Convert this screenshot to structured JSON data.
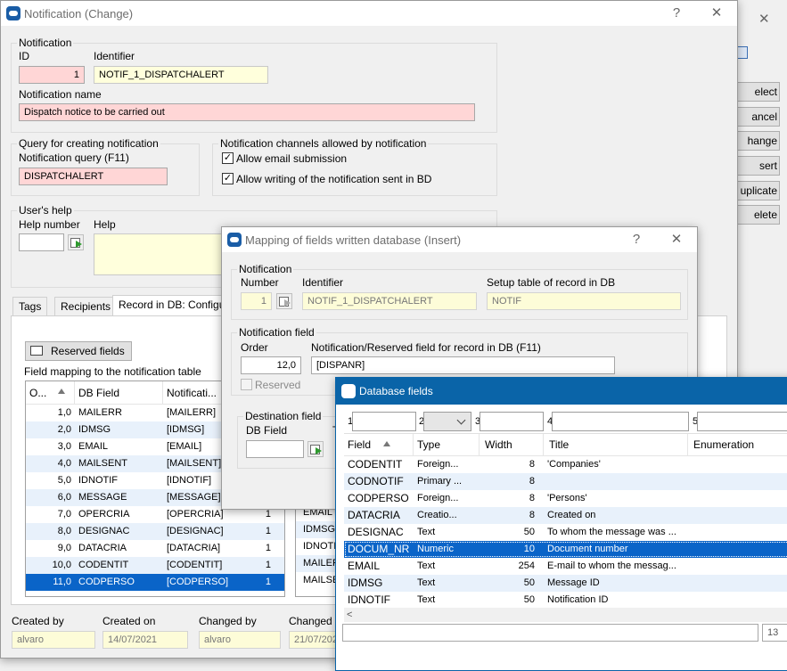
{
  "bg_window": {
    "buttons": [
      "elect",
      "ancel",
      "hange",
      "sert",
      "uplicate",
      "elete"
    ]
  },
  "main_window": {
    "title": "Notification (Change)",
    "help_btn": "?",
    "close_btn": "✕",
    "notification_group": "Notification",
    "id_label": "ID",
    "id_value": "1",
    "identifier_label": "Identifier",
    "identifier_value": "NOTIF_1_DISPATCHALERT",
    "name_label": "Notification name",
    "name_value": "Dispatch notice to be carried out",
    "query_group": "Query for creating notification",
    "query_label": "Notification query (F11)",
    "query_value": "DISPATCHALERT",
    "channels_group": "Notification channels allowed by notification",
    "allow_email": "Allow email submission",
    "allow_db": "Allow writing of the notification sent in BD",
    "help_group": "User's help",
    "help_number_label": "Help number",
    "help_label": "Help",
    "tabs": [
      "Tags",
      "Recipients",
      "Record in DB: Configu"
    ],
    "reserved_fields_btn": "Reserved fields",
    "mapping_label": "Field mapping to the notification table",
    "grid_headers": [
      "O...",
      "DB Field",
      "Notificati..."
    ],
    "grid_rows": [
      {
        "order": "1,0",
        "field": "MAILERR",
        "notif": "[MAILERR]",
        "extra": ""
      },
      {
        "order": "2,0",
        "field": "IDMSG",
        "notif": "[IDMSG]",
        "extra": ""
      },
      {
        "order": "3,0",
        "field": "EMAIL",
        "notif": "[EMAIL]",
        "extra": ""
      },
      {
        "order": "4,0",
        "field": "MAILSENT",
        "notif": "[MAILSENT]",
        "extra": ""
      },
      {
        "order": "5,0",
        "field": "IDNOTIF",
        "notif": "[IDNOTIF]",
        "extra": ""
      },
      {
        "order": "6,0",
        "field": "MESSAGE",
        "notif": "[MESSAGE]",
        "extra": ""
      },
      {
        "order": "7,0",
        "field": "OPERCRIA",
        "notif": "[OPERCRIA]",
        "extra": "1"
      },
      {
        "order": "8,0",
        "field": "DESIGNAC",
        "notif": "[DESIGNAC]",
        "extra": "1"
      },
      {
        "order": "9,0",
        "field": "DATACRIA",
        "notif": "[DATACRIA]",
        "extra": "1"
      },
      {
        "order": "10,0",
        "field": "CODENTIT",
        "notif": "[CODENTIT]",
        "extra": "1"
      },
      {
        "order": "11,0",
        "field": "CODPERSO",
        "notif": "[CODPERSO]",
        "extra": "1"
      }
    ],
    "second_list": [
      "EMAIL",
      "IDMSG",
      "IDNOTIF",
      "MAILER",
      "MAILSE"
    ],
    "created_by_label": "Created by",
    "created_by_value": "alvaro",
    "created_on_label": "Created on",
    "created_on_value": "14/07/2021",
    "changed_by_label": "Changed by",
    "changed_by_value": "alvaro",
    "changed_on_label": "Changed o",
    "changed_on_value": "21/07/202"
  },
  "mapping_window": {
    "title": "Mapping of fields written database (Insert)",
    "help_btn": "?",
    "close_btn": "✕",
    "notification_group": "Notification",
    "number_label": "Number",
    "number_value": "1",
    "identifier_label": "Identifier",
    "identifier_value": "NOTIF_1_DISPATCHALERT",
    "setup_label": "Setup table of record in DB",
    "setup_value": "NOTIF",
    "field_group": "Notification field",
    "order_label": "Order",
    "order_value": "12,0",
    "reserved_field_label": "Notification/Reserved field for record  in DB (F11)",
    "reserved_field_value": "[DISPANR]",
    "reserved_checkbox": "Reserved",
    "dest_group": "Destination field",
    "db_field_label": "DB Field",
    "t_label": "T"
  },
  "db_fields_window": {
    "title": "Database fields",
    "filter_labels": [
      "1",
      "2",
      "3",
      "4",
      "5"
    ],
    "headers": [
      "Field",
      "Type",
      "Width",
      "Title",
      "Enumeration"
    ],
    "rows": [
      {
        "field": "CODENTIT",
        "type": "Foreign...",
        "width": "8",
        "title": "'Companies'"
      },
      {
        "field": "CODNOTIF",
        "type": "Primary ...",
        "width": "8",
        "title": ""
      },
      {
        "field": "CODPERSO",
        "type": "Foreign...",
        "width": "8",
        "title": "'Persons'"
      },
      {
        "field": "DATACRIA",
        "type": "Creatio...",
        "width": "8",
        "title": "Created on"
      },
      {
        "field": "DESIGNAC",
        "type": "Text",
        "width": "50",
        "title": "To whom the message was ..."
      },
      {
        "field": "DOCUM_NR",
        "type": "Numeric",
        "width": "10",
        "title": "Document number"
      },
      {
        "field": "EMAIL",
        "type": "Text",
        "width": "254",
        "title": "E-mail to whom the messag..."
      },
      {
        "field": "IDMSG",
        "type": "Text",
        "width": "50",
        "title": "Message ID"
      },
      {
        "field": "IDNOTIF",
        "type": "Text",
        "width": "50",
        "title": "Notification ID"
      }
    ],
    "selected_index": 5,
    "scroll_left": "<",
    "count_value": "13"
  },
  "colors": {
    "selection": "#0a64c8",
    "title_blue": "#0a64a8",
    "mandatory_pink": "#ffd6d6",
    "readonly_yellow": "#ffffdc"
  }
}
